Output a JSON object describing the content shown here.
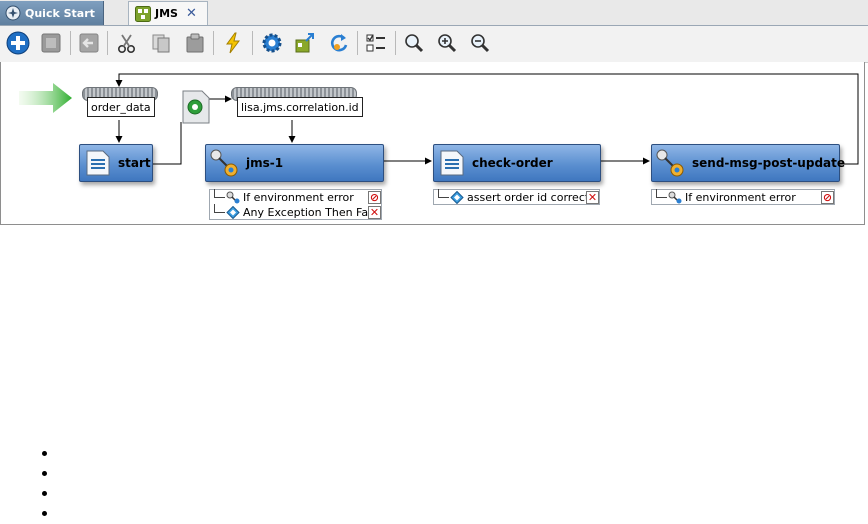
{
  "tabs": [
    {
      "label": "Quick Start",
      "icon": "quick-start-icon",
      "active": false
    },
    {
      "label": "JMS",
      "icon": "test-case-icon",
      "active": true,
      "close": "✕"
    }
  ],
  "toolbar": {
    "items": [
      {
        "name": "add-step-icon"
      },
      {
        "name": "stop-icon"
      },
      {
        "name": "back-icon"
      },
      {
        "name": "cut-icon"
      },
      {
        "name": "copy-icon"
      },
      {
        "name": "paste-icon"
      },
      {
        "name": "run-icon"
      },
      {
        "name": "settings-icon"
      },
      {
        "name": "export-icon"
      },
      {
        "name": "refresh-icon"
      },
      {
        "name": "checklist-icon"
      },
      {
        "name": "zoom-icon"
      },
      {
        "name": "zoom-in-icon"
      },
      {
        "name": "zoom-out-icon"
      }
    ]
  },
  "canvas": {
    "start_arrow": "start-arrow-icon",
    "data_sets": [
      {
        "label": "order_data"
      },
      {
        "label": "lisa.jms.correlation.id"
      }
    ],
    "filter_node": "filter-icon",
    "steps": [
      {
        "title": "start",
        "icon": "document-step-icon",
        "assertions": []
      },
      {
        "title": "jms-1",
        "icon": "jms-step-icon",
        "assertions": [
          {
            "label": "If environment error",
            "icon": "env-error-icon",
            "badge": "⊘",
            "badge_color": "#d01010"
          },
          {
            "label": "Any Exception Then Fail",
            "icon": "assert-diamond-icon",
            "badge": "✕",
            "badge_color": "#d01010"
          }
        ]
      },
      {
        "title": "check-order",
        "icon": "document-step-icon",
        "assertions": [
          {
            "label": "assert order id correct",
            "icon": "assert-diamond-icon",
            "badge": "✕",
            "badge_color": "#d01010"
          }
        ]
      },
      {
        "title": "send-msg-post-update",
        "icon": "jms-step-icon",
        "assertions": [
          {
            "label": "If environment error",
            "icon": "env-error-icon",
            "badge": "⊘",
            "badge_color": "#d01010"
          }
        ]
      }
    ]
  },
  "bullets": [
    "",
    "",
    "",
    ""
  ],
  "colors": {
    "step_blue": "#5b8fd0",
    "start_arrow_green": "#3fb43f",
    "tab_active_bg": "#f7f7f7",
    "tab_inactive_bg": "#6f8faf"
  }
}
